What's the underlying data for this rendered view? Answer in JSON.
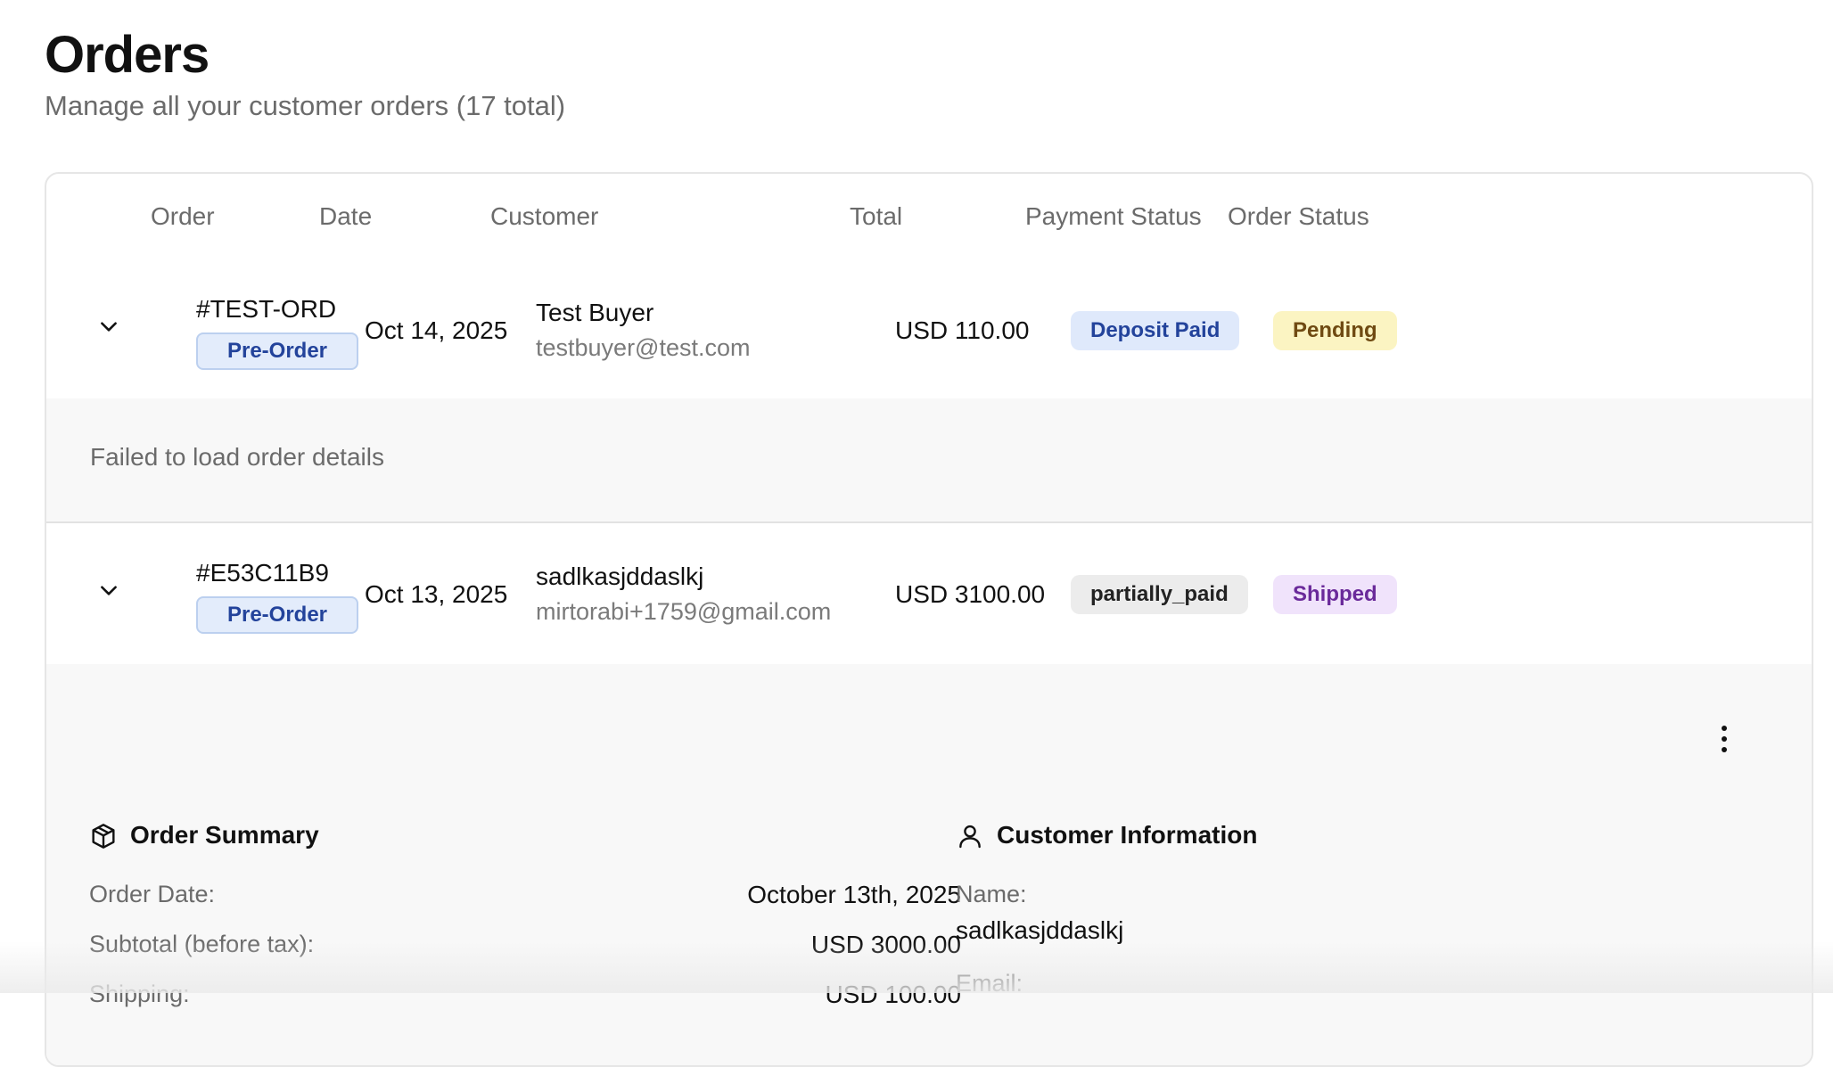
{
  "page": {
    "title": "Orders",
    "subtitle": "Manage all your customer orders (17 total)"
  },
  "table": {
    "columns": [
      "Order",
      "Date",
      "Customer",
      "Total",
      "Payment Status",
      "Order Status"
    ],
    "rows": [
      {
        "order_id": "#TEST-ORD",
        "type_badge": "Pre-Order",
        "date": "Oct 14, 2025",
        "customer_name": "Test Buyer",
        "customer_email": "testbuyer@test.com",
        "total": "USD 110.00",
        "payment_status": "Deposit Paid",
        "order_status": "Pending"
      },
      {
        "order_id": "#E53C11B9",
        "type_badge": "Pre-Order",
        "date": "Oct 13, 2025",
        "customer_name": "sadlkasjddaslkj",
        "customer_email": "mirtorabi+1759@gmail.com",
        "total": "USD 3100.00",
        "payment_status": "partially_paid",
        "order_status": "Shipped"
      }
    ],
    "row1_error": "Failed to load order details"
  },
  "details": {
    "order_summary": {
      "heading": "Order Summary",
      "order_date_label": "Order Date:",
      "order_date_value": "October 13th, 2025",
      "subtotal_label": "Subtotal (before tax):",
      "subtotal_value": "USD 3000.00",
      "shipping_label": "Shipping:",
      "shipping_value": "USD 100.00"
    },
    "customer_info": {
      "heading": "Customer Information",
      "name_label": "Name:",
      "name_value": "sadlkasjddaslkj",
      "email_label": "Email:"
    }
  },
  "icons": {
    "expand": "chevron-down-icon",
    "more": "more-vertical-icon",
    "summary": "package-icon",
    "customer": "user-icon"
  },
  "colors": {
    "preorder_badge": "#e3ecfb",
    "deposit_paid": "#dfe9fb",
    "pending": "#fbf4c2",
    "partially_paid": "#ececec",
    "shipped": "#f0e3fb"
  }
}
